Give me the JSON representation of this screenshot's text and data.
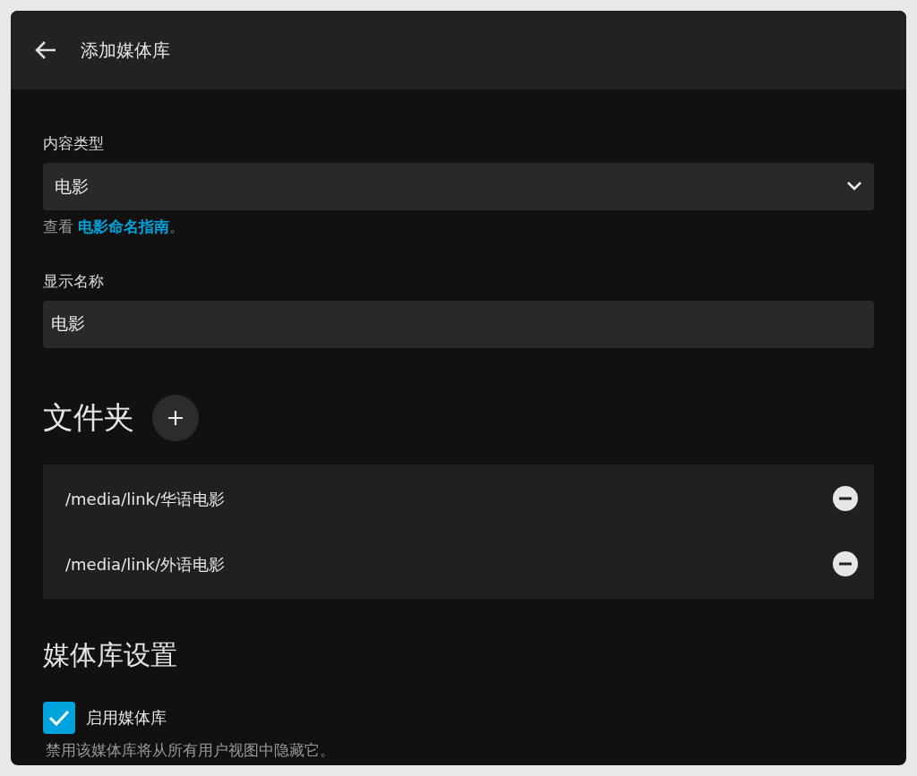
{
  "header": {
    "title": "添加媒体库"
  },
  "content_type": {
    "label": "内容类型",
    "value": "电影",
    "hint_prefix": "查看 ",
    "hint_link": "电影命名指南",
    "hint_suffix": "。"
  },
  "display_name": {
    "label": "显示名称",
    "value": "电影"
  },
  "folders": {
    "title": "文件夹",
    "items": [
      {
        "path": "/media/link/华语电影"
      },
      {
        "path": "/media/link/外语电影"
      }
    ]
  },
  "settings": {
    "title": "媒体库设置",
    "enable": {
      "label": "启用媒体库",
      "checked": true,
      "hint": "禁用该媒体库将从所有用户视图中隐藏它。"
    }
  }
}
